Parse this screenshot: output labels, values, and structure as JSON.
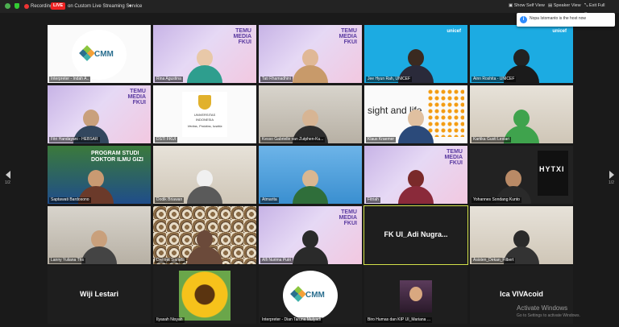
{
  "topbar": {
    "recording_label": "Recording",
    "live_badge": "LIVE",
    "live_target": "on Custom Live Streaming Service",
    "show_self_view": "Show Self View",
    "speaker_view": "Speaker View",
    "exit_full_screen": "Exit Full Screen"
  },
  "notification": {
    "text": "Nopa Istomanto is the host now"
  },
  "nav": {
    "left_page": "1/2",
    "right_page": "1/2"
  },
  "tiles": [
    {
      "name": "Interpreter - Indah A..",
      "kind": "cmm"
    },
    {
      "name": "Rina Agustina",
      "kind": "temu",
      "temu_title": "TEMU MEDIA FKUI"
    },
    {
      "name": "Tati Rhamadhini",
      "kind": "temu",
      "temu_title": "TEMU MEDIA FKUI"
    },
    {
      "name": "Jee Hyun Rah, UNICEF",
      "kind": "unicef",
      "logo": "unicef"
    },
    {
      "name": "Ainn Roshita - UNICEF",
      "kind": "unicef",
      "logo": "unicef"
    },
    {
      "name": "Fitri Handayani - HEBSAR",
      "kind": "temu",
      "temu_title": "TEMU MEDIA FKUI"
    },
    {
      "name": "DSTI FKUI",
      "kind": "ui",
      "ui_line1": "UNIVERSITAS",
      "ui_line2": "INDONESIA",
      "ui_motto": "Veritas, Probitas, Iustitia"
    },
    {
      "name": "Kesso Gabrielle van Zutphen-Ku...",
      "kind": "room"
    },
    {
      "name": "Klaus Kraemer",
      "kind": "sight",
      "logo_text": "sight and life"
    },
    {
      "name": "Kartika Gusti Lestari",
      "kind": "office"
    },
    {
      "name": "Saptawati Bardosono",
      "kind": "program",
      "program_text": "PROGRAM STUDI DOKTOR ILMU GIZI"
    },
    {
      "name": "Dodik Briawan",
      "kind": "office"
    },
    {
      "name": "Atmarita",
      "kind": "sky"
    },
    {
      "name": "Fitriah",
      "kind": "temu",
      "temu_title": "TEMU MEDIA FKUI"
    },
    {
      "name": "Yohannes Sondang Kunto",
      "kind": "book",
      "book_text": "HYTXI"
    },
    {
      "name": "Lanny Yuliana Ths",
      "kind": "room"
    },
    {
      "name": "Dwinna Sianida",
      "kind": "batik"
    },
    {
      "name": "Alfi Nurima Putri",
      "kind": "temu",
      "temu_title": "TEMU MEDIA FKUI"
    },
    {
      "name": "FK UI_Adi Nugra...",
      "kind": "name"
    },
    {
      "name": "Asisten_Dekan_Filbert",
      "kind": "office"
    },
    {
      "name": "Wiji Lestari",
      "kind": "name"
    },
    {
      "name": "Ilyasah Nisyah",
      "kind": "sunflower"
    },
    {
      "name": "Interpreter - Dian Taruna Mulyadi",
      "kind": "cmm"
    },
    {
      "name": "Biro Humas dan KIP UI_Mariana ...",
      "kind": "photo"
    },
    {
      "name": "Ica VIVAcoid",
      "kind": "name"
    }
  ],
  "cmm_logo": "CMM",
  "watermark": {
    "line1": "Activate Windows",
    "line2": "Go to Settings to activate Windows."
  },
  "colors": {
    "live_red": "#e22222",
    "active_speaker": "#d4e24a",
    "notify_blue": "#2d8cff"
  }
}
